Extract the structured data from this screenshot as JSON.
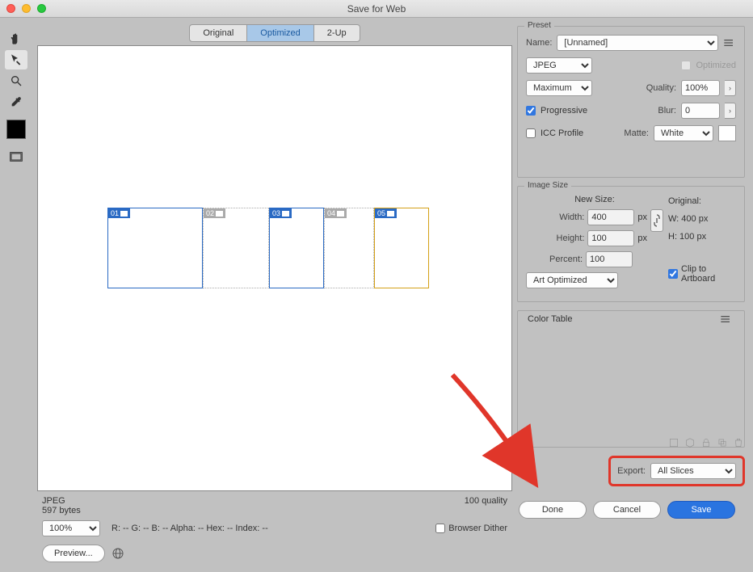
{
  "window": {
    "title": "Save for Web"
  },
  "tabs": {
    "original": "Original",
    "optimized": "Optimized",
    "twoup": "2-Up"
  },
  "slices": [
    {
      "num": "01",
      "selected": true,
      "width": 118
    },
    {
      "num": "02",
      "selected": false,
      "width": 82
    },
    {
      "num": "03",
      "selected": true,
      "width": 68
    },
    {
      "num": "04",
      "selected": false,
      "width": 62
    },
    {
      "num": "05",
      "selected": true,
      "width": 68,
      "gold": true
    }
  ],
  "canvas_footer": {
    "format": "JPEG",
    "size": "597 bytes",
    "quality": "100 quality"
  },
  "zoom": {
    "value": "100%",
    "info": "R: -- G: -- B: -- Alpha: -- Hex: -- Index: --"
  },
  "browser_dither": {
    "label": "Browser Dither",
    "checked": false
  },
  "preview_btn": "Preview...",
  "preset": {
    "section": "Preset",
    "name_label": "Name:",
    "name_value": "[Unnamed]",
    "format": "JPEG",
    "optimized_label": "Optimized",
    "optimized_checked": false,
    "quality_preset": "Maximum",
    "quality_label": "Quality:",
    "quality_value": "100%",
    "progressive_label": "Progressive",
    "progressive_checked": true,
    "blur_label": "Blur:",
    "blur_value": "0",
    "icc_label": "ICC Profile",
    "icc_checked": false,
    "matte_label": "Matte:",
    "matte_value": "White"
  },
  "image_size": {
    "section": "Image Size",
    "new_size_label": "New Size:",
    "original_label": "Original:",
    "width_label": "Width:",
    "width_value": "400",
    "width_unit": "px",
    "orig_w": "W:  400 px",
    "height_label": "Height:",
    "height_value": "100",
    "height_unit": "px",
    "orig_h": "H:  100 px",
    "percent_label": "Percent:",
    "percent_value": "100",
    "interp": "Art Optimized",
    "clip_label": "Clip to Artboard",
    "clip_checked": true
  },
  "color_table": {
    "section": "Color Table"
  },
  "export": {
    "label": "Export:",
    "value": "All Slices"
  },
  "buttons": {
    "done": "Done",
    "cancel": "Cancel",
    "save": "Save"
  }
}
